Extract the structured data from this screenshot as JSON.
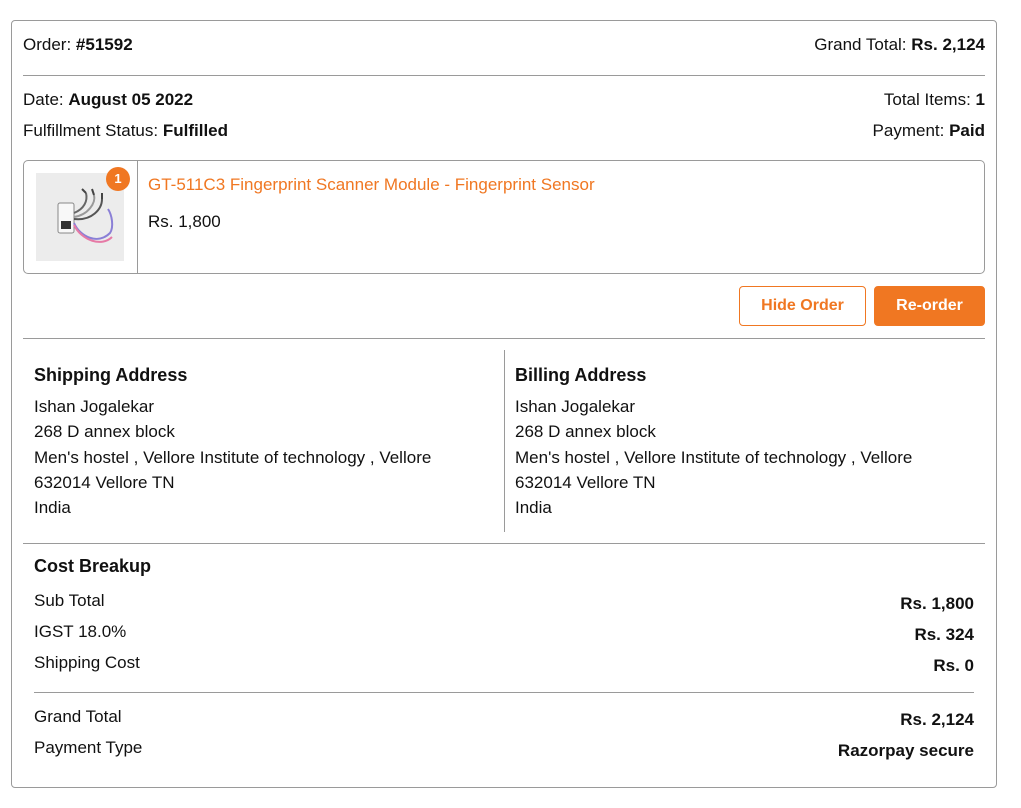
{
  "header": {
    "order_label": "Order:",
    "order_number": "#51592",
    "grand_total_label": "Grand Total:",
    "grand_total_value": "Rs. 2,124"
  },
  "meta": {
    "date_label": "Date:",
    "date_value": "August 05 2022",
    "total_items_label": "Total Items:",
    "total_items_value": "1",
    "fulfillment_label": "Fulfillment Status:",
    "fulfillment_value": "Fulfilled",
    "payment_label": "Payment:",
    "payment_value": "Paid"
  },
  "item": {
    "quantity": "1",
    "title": "GT-511C3 Fingerprint Scanner Module - Fingerprint Sensor",
    "price": "Rs. 1,800"
  },
  "actions": {
    "hide_label": "Hide Order",
    "reorder_label": "Re-order"
  },
  "shipping": {
    "title": "Shipping Address",
    "lines": [
      "Ishan Jogalekar",
      "268 D annex block",
      "Men's hostel , Vellore Institute of technology , Vellore",
      "632014 Vellore TN",
      "India"
    ]
  },
  "billing": {
    "title": "Billing Address",
    "lines": [
      "Ishan Jogalekar",
      "268 D annex block",
      "Men's hostel , Vellore Institute of technology , Vellore",
      "632014 Vellore TN",
      "India"
    ]
  },
  "cost": {
    "title": "Cost Breakup",
    "subtotal_label": "Sub Total",
    "subtotal_value": "Rs. 1,800",
    "igst_label": "IGST 18.0%",
    "igst_value": "Rs. 324",
    "shipping_label": "Shipping Cost",
    "shipping_value": "Rs. 0",
    "grand_total_label": "Grand Total",
    "grand_total_value": "Rs. 2,124",
    "payment_type_label": "Payment Type",
    "payment_type_value": "Razorpay secure"
  },
  "colors": {
    "accent": "#f07722",
    "border": "#9a9a9a"
  }
}
